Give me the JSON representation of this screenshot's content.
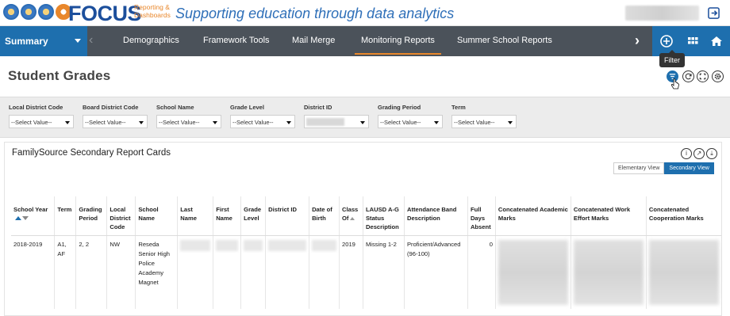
{
  "header": {
    "brand": "FOCUS",
    "brand_sub_1": "Reporting &",
    "brand_sub_2": "Dashboards",
    "tagline": "Supporting education through data analytics"
  },
  "nav": {
    "summary_label": "Summary",
    "items": [
      "Demographics",
      "Framework Tools",
      "Mail Merge",
      "Monitoring Reports",
      "Summer School Reports"
    ],
    "active": "Monitoring Reports"
  },
  "tooltip": "Filter",
  "page": {
    "title": "Student Grades"
  },
  "filters": [
    {
      "label": "Local District Code",
      "value": "--Select Value--"
    },
    {
      "label": "Board District Code",
      "value": "--Select Value--"
    },
    {
      "label": "School Name",
      "value": "--Select Value--"
    },
    {
      "label": "Grade Level",
      "value": "--Select Value--"
    },
    {
      "label": "District ID",
      "value": ""
    },
    {
      "label": "Grading Period",
      "value": "--Select Value--"
    },
    {
      "label": "Term",
      "value": "--Select Value--"
    }
  ],
  "report": {
    "title": "FamilySource Secondary Report Cards",
    "elementary_view": "Elementary View",
    "secondary_view": "Secondary View",
    "columns": [
      "School Year",
      "Term",
      "Grading Period",
      "Local District Code",
      "School Name",
      "Last Name",
      "First Name",
      "Grade Level",
      "District ID",
      "Date of Birth",
      "Class Of",
      "LAUSD A-G Status Description",
      "Attendance Band Description",
      "Full Days Absent",
      "Concatenated Academic Marks",
      "Concatenated Work Effort Marks",
      "Concatenated Cooperation Marks"
    ],
    "row": {
      "school_year": "2018-2019",
      "term": "A1, AF",
      "grading_period": "2, 2",
      "local_district": "NW",
      "school_name": "Reseda Senior High Police Academy Magnet",
      "class_of": "2019",
      "ag_status": "Missing 1-2",
      "attendance_band": "Proficient/Advanced (96-100)",
      "days_absent": "0"
    }
  },
  "icons": {
    "header": [
      "district-seal-icon",
      "board-seal-icon",
      "school-seal-icon",
      "focus-logo-icon",
      "logout-icon"
    ],
    "nav": [
      "chevron-left-icon",
      "chevron-right-icon",
      "add-circle-icon",
      "grid-icon",
      "home-icon"
    ],
    "tools": [
      "filter-icon",
      "refresh-icon",
      "expand-icon",
      "settings-icon"
    ],
    "panel": [
      "info-icon",
      "open-external-icon",
      "download-icon"
    ]
  },
  "colors": {
    "brand_blue": "#1e6fae",
    "nav_gray": "#4b525a",
    "accent_orange": "#e9872b"
  }
}
